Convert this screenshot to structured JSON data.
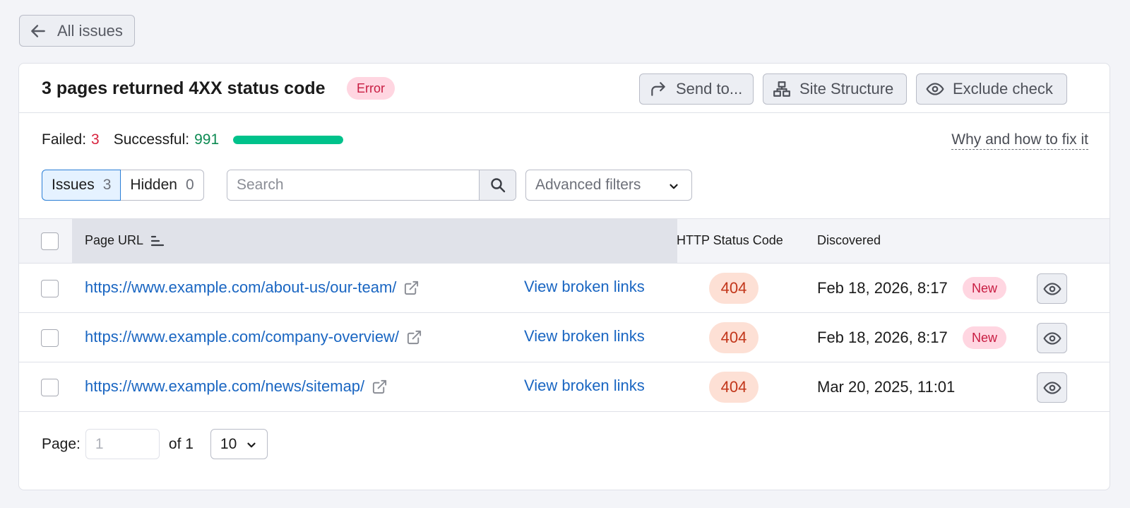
{
  "nav": {
    "back_label": "All issues"
  },
  "header": {
    "title": "3 pages returned 4XX status code",
    "severity": "Error",
    "send_to": "Send to...",
    "site_structure": "Site Structure",
    "exclude_check": "Exclude check"
  },
  "stats": {
    "failed_label": "Failed:",
    "failed_value": "3",
    "successful_label": "Successful:",
    "successful_value": "991",
    "progress_fraction": 0.997,
    "howto_link": "Why and how to fix it"
  },
  "filters": {
    "tabs": [
      {
        "label": "Issues",
        "count": "3",
        "active": true
      },
      {
        "label": "Hidden",
        "count": "0",
        "active": false
      }
    ],
    "search_placeholder": "Search",
    "advanced": "Advanced filters"
  },
  "table": {
    "columns": {
      "url": "Page URL",
      "status": "HTTP Status Code",
      "discovered": "Discovered"
    },
    "rows": [
      {
        "url": "https://www.example.com/about-us/our-team/",
        "action": "View broken links",
        "status": "404",
        "discovered": "Feb 18, 2026, 8:17",
        "badge": "New"
      },
      {
        "url": "https://www.example.com/company-overview/",
        "action": "View broken links",
        "status": "404",
        "discovered": "Feb 18, 2026, 8:17",
        "badge": "New"
      },
      {
        "url": "https://www.example.com/news/sitemap/",
        "action": "View broken links",
        "status": "404",
        "discovered": "Mar 20, 2025, 11:01",
        "badge": ""
      }
    ]
  },
  "pagination": {
    "page_label": "Page:",
    "page_placeholder": "1",
    "of_label": "of 1",
    "page_size": "10"
  },
  "colors": {
    "link": "#1a66c2",
    "error": "#c81d42",
    "success": "#00c28b"
  }
}
